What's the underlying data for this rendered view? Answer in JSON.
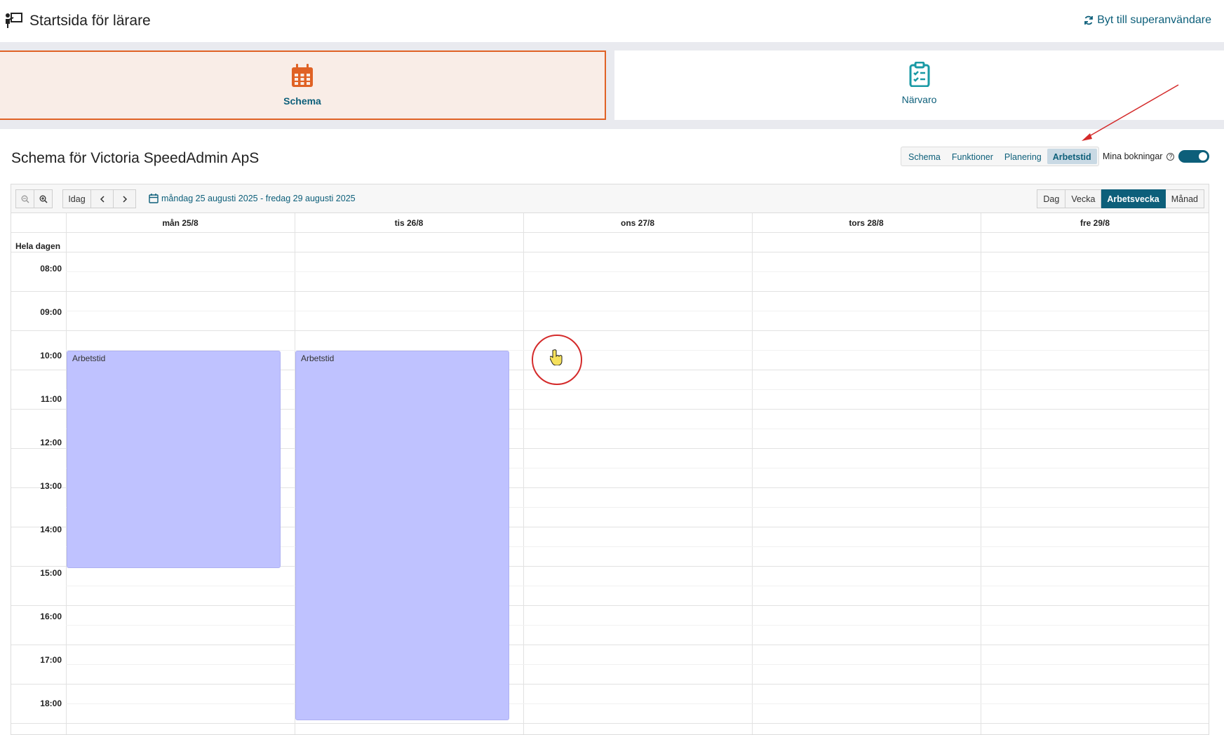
{
  "header": {
    "title": "Startsida för lärare",
    "switch_user_label": "Byt till superanvändare"
  },
  "tiles": [
    {
      "label": "Schema",
      "icon": "calendar-icon",
      "active": true
    },
    {
      "label": "Närvaro",
      "icon": "clipboard-icon",
      "active": false
    }
  ],
  "schedule": {
    "title": "Schema för Victoria SpeedAdmin ApS",
    "mode_tabs": [
      "Schema",
      "Funktioner",
      "Planering",
      "Arbetstid"
    ],
    "active_mode": "Arbetstid",
    "bookings_label": "Mina bokningar",
    "bookings_toggle_on": true
  },
  "calendar": {
    "today_label": "Idag",
    "date_range": "måndag 25 augusti 2025 - fredag 29 augusti 2025",
    "views": [
      "Dag",
      "Vecka",
      "Arbetsvecka",
      "Månad"
    ],
    "active_view": "Arbetsvecka",
    "days": [
      "mån 25/8",
      "tis 26/8",
      "ons 27/8",
      "tors 28/8",
      "fre 29/8"
    ],
    "all_day_label": "Hela dagen",
    "times": [
      "08:00",
      "09:00",
      "10:00",
      "11:00",
      "12:00",
      "13:00",
      "14:00",
      "15:00",
      "16:00",
      "17:00",
      "18:00"
    ],
    "events": [
      {
        "title": "Arbetstid",
        "day": 0,
        "start": "10:00",
        "end": "15:00"
      },
      {
        "title": "Arbetstid",
        "day": 1,
        "start": "10:00",
        "end": "18:30"
      }
    ]
  },
  "colors": {
    "accent": "#0d5f7a",
    "active_tile_border": "#e06225",
    "active_tile_bg": "#f9ede7",
    "event_bg": "#bfc2ff",
    "annotation": "#d42a2a"
  }
}
